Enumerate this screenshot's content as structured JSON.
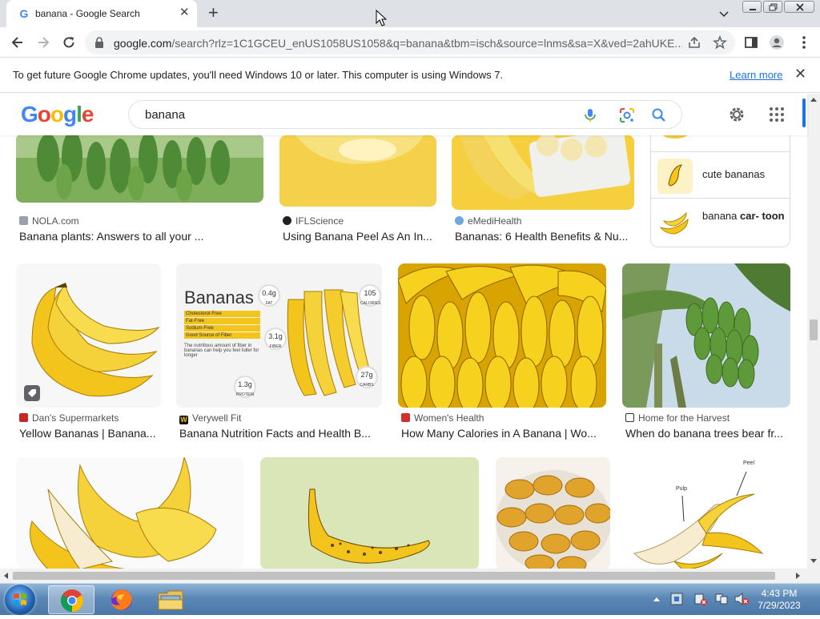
{
  "browser": {
    "tab": {
      "title": "banana - Google Search",
      "close_glyph": "✕",
      "favicon": "G"
    },
    "new_tab_glyph": "+",
    "url": {
      "host": "google.com",
      "rest": "/search?rlz=1C1GCEU_enUS1058US1058&q=banana&tbm=isch&source=lnms&sa=X&ved=2ahUKE..."
    }
  },
  "infobar": {
    "message": "To get future Google Chrome updates, you'll need Windows 10 or later. This computer is using Windows 7.",
    "link": "Learn more",
    "close_glyph": "✕"
  },
  "google": {
    "logo_letters": [
      "G",
      "o",
      "o",
      "g",
      "l",
      "e"
    ],
    "logo_colors": [
      "#4285f4",
      "#ea4335",
      "#fbbc05",
      "#4285f4",
      "#34a853",
      "#ea4335"
    ],
    "query": "banana"
  },
  "results": {
    "row1": [
      {
        "source": "NOLA.com",
        "caption": "Banana plants: Answers to all your ...",
        "fav_color": "#9aa0a6"
      },
      {
        "source": "IFLScience",
        "caption": "Using Banana Peel As An In...",
        "fav_color": "#202124"
      },
      {
        "source": "eMediHealth",
        "caption": "Bananas: 6 Health Benefits & Nu...",
        "fav_color": "#6fa8dc"
      }
    ],
    "related": [
      {
        "label": "cute bananas"
      },
      {
        "label_plain": "banana ",
        "label_bold": "car- toon"
      }
    ],
    "row2": [
      {
        "source": "Dan's Supermarkets",
        "caption": "Yellow Bananas | Banana...",
        "fav_color": "#c62828"
      },
      {
        "source": "Verywell Fit",
        "caption": "Banana Nutrition Facts and Health B...",
        "fav_color": "#111111",
        "fav_letter": "W"
      },
      {
        "source": "Women's Health",
        "caption": "How Many Calories in A Banana | Wo...",
        "fav_color": "#d32f2f"
      },
      {
        "source": "Home for the Harvest",
        "caption": "When do banana trees bear fr...",
        "fav_color": "#ffffff"
      }
    ],
    "nutrition_card": {
      "title": "Bananas",
      "bullets": [
        "Cholesterol-Free",
        "Fat-Free",
        "Sodium-Free",
        "Good Source of Fiber"
      ],
      "note": "The nutritious amount of fiber in bananas can help you feel fuller for longer",
      "badges": [
        {
          "value": "0.4g",
          "label": "FAT"
        },
        {
          "value": "105",
          "label": "CALORIES"
        },
        {
          "value": "3.1g",
          "label": "FIBER"
        },
        {
          "value": "1.3g",
          "label": "PROTEIN"
        },
        {
          "value": "27g",
          "label": "CARBS"
        }
      ]
    },
    "diagram_labels": [
      "Peel",
      "Pulp"
    ]
  },
  "taskbar": {
    "time": "4:43 PM",
    "date": "7/29/2023"
  }
}
